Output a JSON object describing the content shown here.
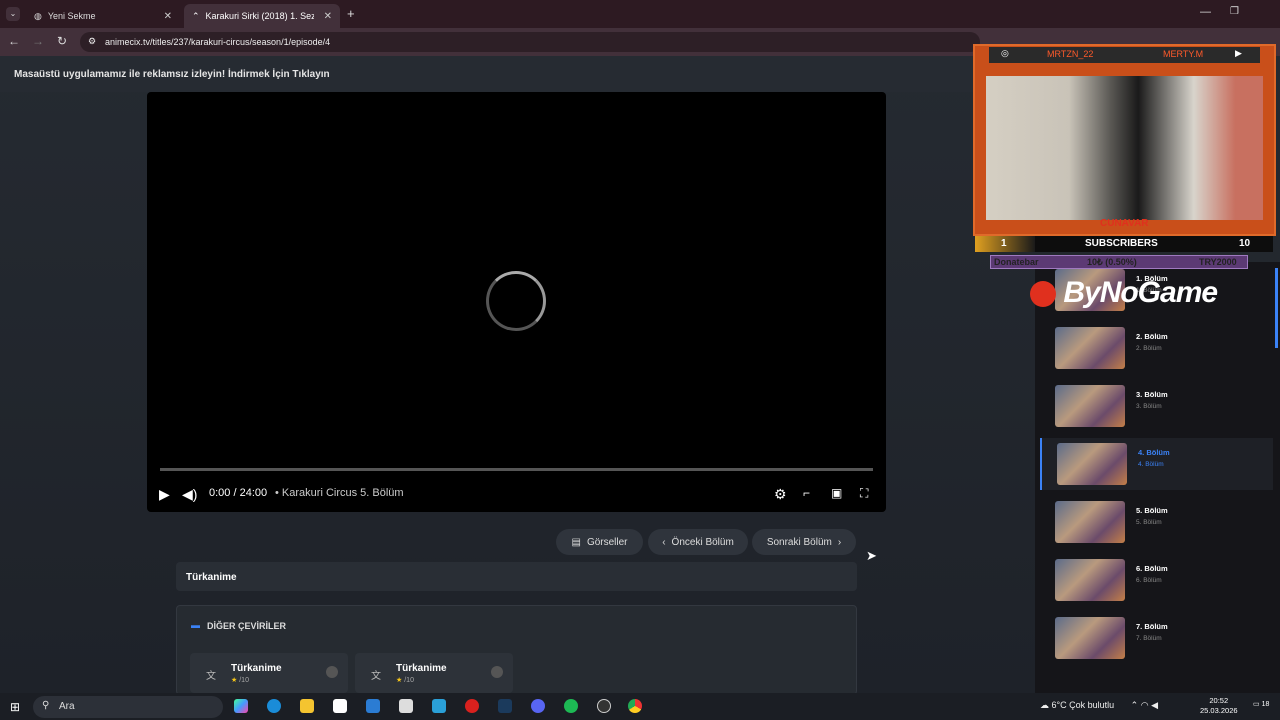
{
  "browser": {
    "tabs": [
      {
        "title": "Yeni Sekme"
      },
      {
        "title": "Karakuri Sirki (2018) 1. Sezon 4"
      }
    ],
    "url": "animecix.tv/titles/237/karakuri-circus/season/1/episode/4"
  },
  "promo": "Masaüstü uygulamamız ile reklamsız izleyin! İndirmek İçin Tıklayın",
  "player": {
    "current_time": "0:00",
    "duration": "/ 24:00",
    "separator": "•",
    "episode_title": "Karakuri Circus 5. Bölüm",
    "progress": 0
  },
  "actions": {
    "gallery": "Görseller",
    "prev": "Önceki Bölüm",
    "next": "Sonraki Bölüm"
  },
  "fansub": "Türkanime",
  "other_translations": {
    "title": "DİĞER ÇEVİRİLER",
    "cards": [
      {
        "name": "Türkanime",
        "rating": "/10"
      },
      {
        "name": "Türkanime",
        "rating": "/10"
      }
    ]
  },
  "episodes": [
    {
      "title": "1. Bölüm",
      "sub": "1. Bölüm",
      "active": false
    },
    {
      "title": "2. Bölüm",
      "sub": "2. Bölüm",
      "active": false
    },
    {
      "title": "3. Bölüm",
      "sub": "3. Bölüm",
      "active": false
    },
    {
      "title": "4. Bölüm",
      "sub": "4. Bölüm",
      "active": true
    },
    {
      "title": "5. Bölüm",
      "sub": "5. Bölüm",
      "active": false
    },
    {
      "title": "6. Bölüm",
      "sub": "6. Bölüm",
      "active": false
    },
    {
      "title": "7. Bölüm",
      "sub": "7. Bölüm",
      "active": false
    }
  ],
  "stream_overlay": {
    "instagram": "MRTZN_22",
    "youtube": "MERTY.M",
    "cam_name": "CUNAVAR",
    "subs_left": "1",
    "subs_label": "SUBSCRIBERS",
    "subs_right": "10",
    "donate_label": "Donatebar",
    "donate_progress": "10₺ (0.50%)",
    "donate_goal": "TRY2000",
    "logo": "ByNoGame"
  },
  "taskbar": {
    "search": "Ara",
    "weather": "6°C  Çok bulutlu",
    "time": "20:52",
    "date": "25.03.2026",
    "notif": "18"
  }
}
